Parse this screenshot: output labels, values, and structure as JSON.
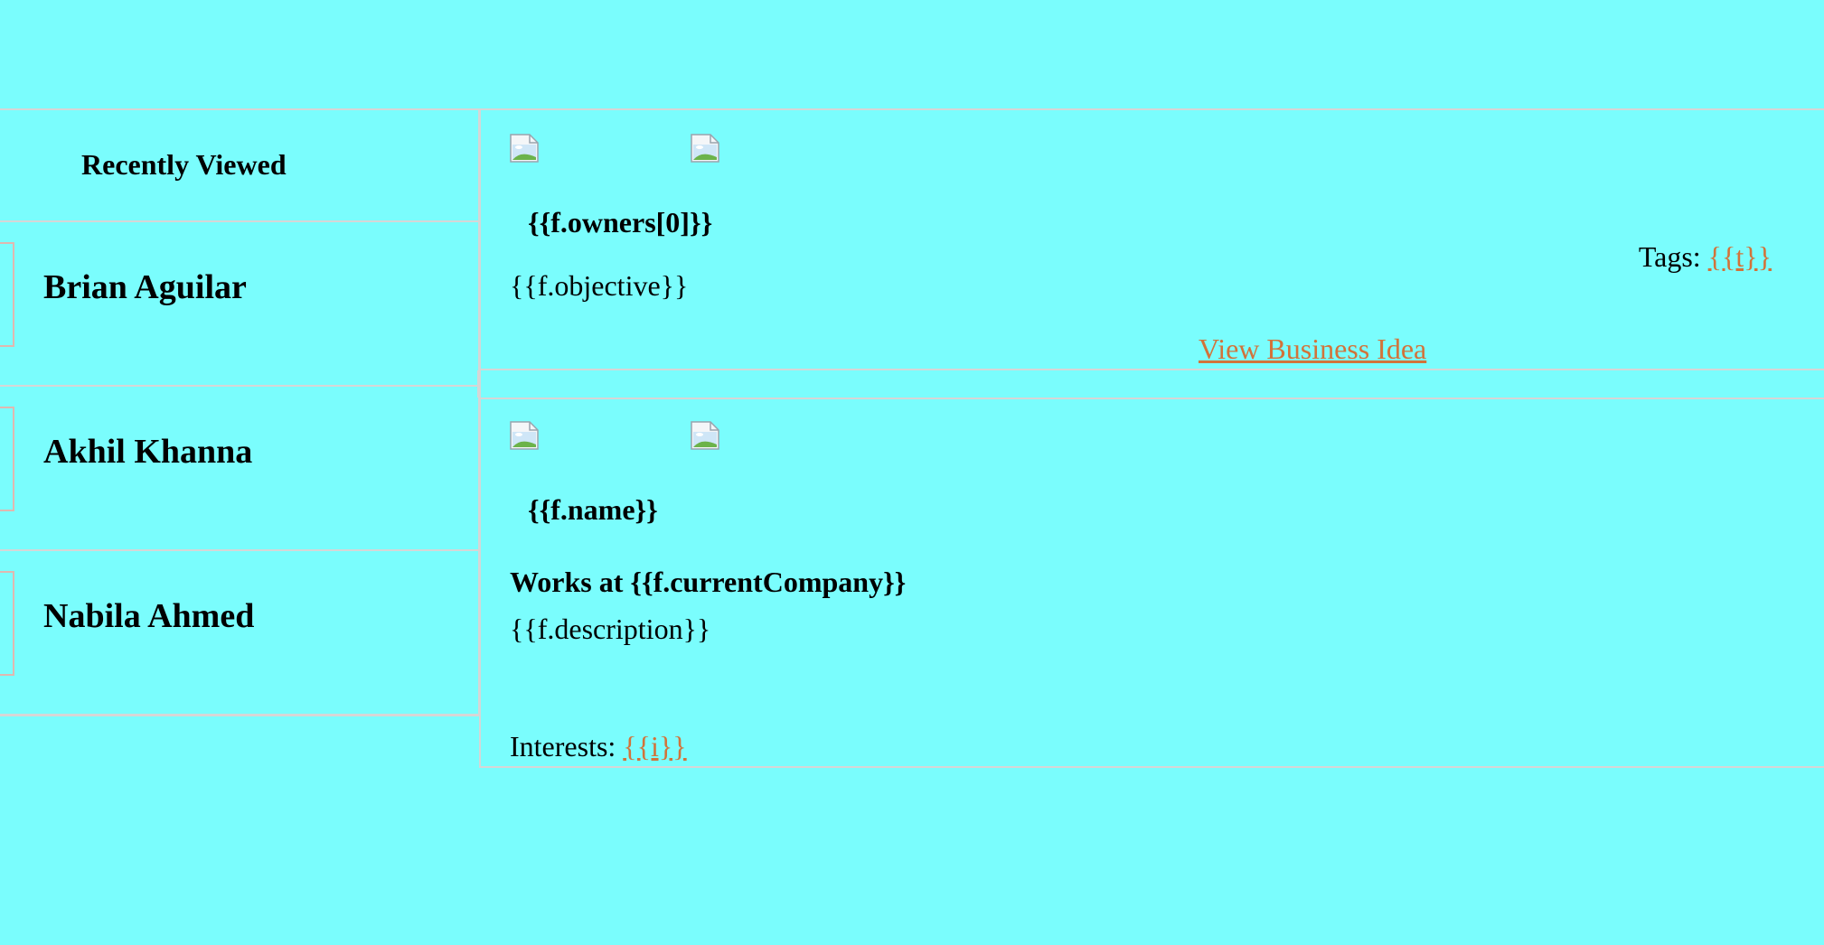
{
  "sidebar": {
    "title": "Recently Viewed",
    "people": [
      {
        "name": "Brian Aguilar"
      },
      {
        "name": "Akhil Khanna"
      },
      {
        "name": "Nabila Ahmed"
      }
    ]
  },
  "idea_card": {
    "owner": "{{f.owners[0]}}",
    "objective": "{{f.objective}}",
    "tags_label": "Tags:",
    "tag_value": "{{t}}",
    "view_link": "View Business Idea"
  },
  "person_card": {
    "name": "{{f.name}}",
    "works_at": "Works at {{f.currentCompany}}",
    "description": "{{f.description}}",
    "interests_label": "Interests:",
    "interest_value": "{{i}}"
  },
  "icons": {
    "broken_image": "broken-image-icon"
  },
  "colors": {
    "background": "#7afdfd",
    "link": "#d2733a",
    "divider": "#d6d6d6"
  }
}
